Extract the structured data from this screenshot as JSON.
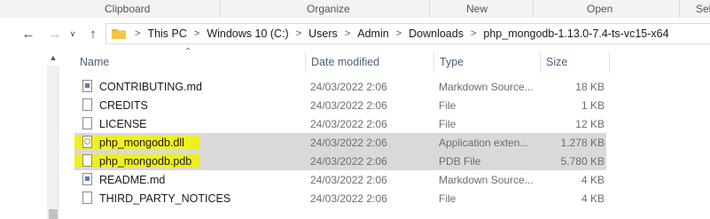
{
  "ribbon": {
    "groups": [
      "Clipboard",
      "Organize",
      "New",
      "Open",
      "Sel"
    ]
  },
  "nav": {
    "back_icon": "arrow-left-icon",
    "forward_icon": "arrow-right-icon",
    "recent_icon": "chevron-down-icon",
    "up_icon": "arrow-up-icon"
  },
  "address": {
    "segments": [
      "This PC",
      "Windows 10 (C:)",
      "Users",
      "Admin",
      "Downloads",
      "php_mongodb-1.13.0-7.4-ts-vc15-x64"
    ],
    "separator": ">"
  },
  "columns": {
    "name": "Name",
    "date": "Date modified",
    "type": "Type",
    "size": "Size"
  },
  "files": [
    {
      "name": "CONTRIBUTING.md",
      "date": "24/03/2022 2:06",
      "type": "Markdown Source...",
      "size": "18 KB",
      "icon": "md"
    },
    {
      "name": "CREDITS",
      "date": "24/03/2022 2:06",
      "type": "File",
      "size": "1 KB",
      "icon": "file"
    },
    {
      "name": "LICENSE",
      "date": "24/03/2022 2:06",
      "type": "File",
      "size": "12 KB",
      "icon": "file"
    },
    {
      "name": "php_mongodb.dll",
      "date": "24/03/2022 2:06",
      "type": "Application exten...",
      "size": "1.278 KB",
      "icon": "dll",
      "selected": true,
      "highlighted": true
    },
    {
      "name": "php_mongodb.pdb",
      "date": "24/03/2022 2:06",
      "type": "PDB File",
      "size": "5.780 KB",
      "icon": "file",
      "selected": true,
      "highlighted": true
    },
    {
      "name": "README.md",
      "date": "24/03/2022 2:06",
      "type": "Markdown Source...",
      "size": "4 KB",
      "icon": "md"
    },
    {
      "name": "THIRD_PARTY_NOTICES",
      "date": "24/03/2022 2:06",
      "type": "File",
      "size": "4 KB",
      "icon": "file"
    }
  ],
  "colors": {
    "selection": "#d9d9d9",
    "highlight": "#f2f200",
    "folder": "#e8b730"
  }
}
